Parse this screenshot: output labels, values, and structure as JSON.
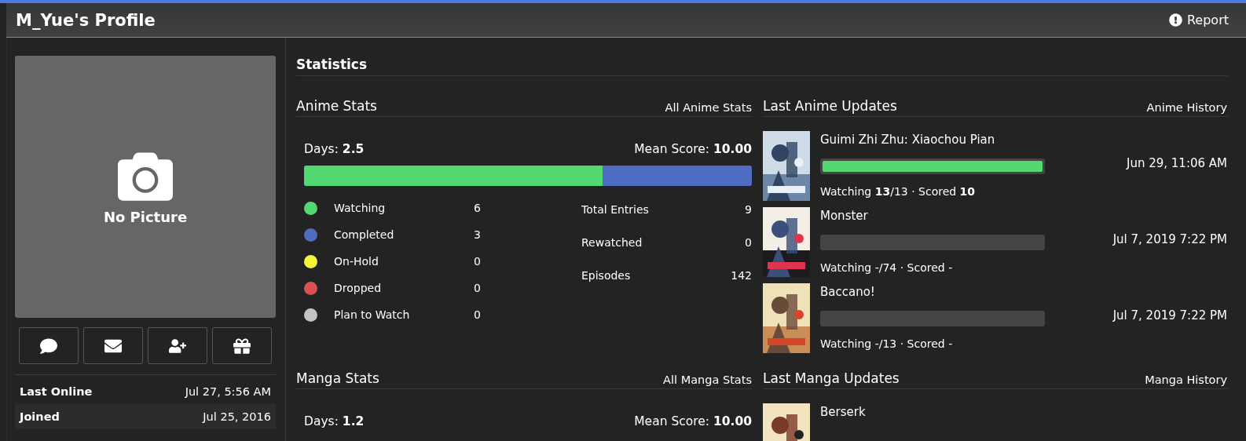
{
  "header": {
    "title": "M_Yue's Profile",
    "report": "Report"
  },
  "sidebar": {
    "picture_label": "No Picture",
    "buttons": [
      {
        "kind": "comment"
      },
      {
        "kind": "mail"
      },
      {
        "kind": "friend"
      },
      {
        "kind": "gift"
      }
    ],
    "info": [
      {
        "label": "Last Online",
        "value": "Jul 27, 5:56 AM"
      },
      {
        "label": "Joined",
        "value": "Jul 25, 2016"
      }
    ]
  },
  "statistics": {
    "title": "Statistics",
    "anime": {
      "title": "Anime Stats",
      "link": "All Anime Stats",
      "days_label": "Days:",
      "days": "2.5",
      "mean_label": "Mean Score:",
      "mean": "10.00",
      "level": 0.667,
      "statuses": [
        {
          "label": "Watching",
          "count": "6",
          "color": "#54d872"
        },
        {
          "label": "Completed",
          "count": "3",
          "color": "#4e6dc2"
        },
        {
          "label": "On-Hold",
          "count": "0",
          "color": "#f5f53a"
        },
        {
          "label": "Dropped",
          "count": "0",
          "color": "#d95151"
        },
        {
          "label": "Plan to Watch",
          "count": "0",
          "color": "#c3c3c3"
        }
      ],
      "totals": [
        {
          "label": "Total Entries",
          "value": "9"
        },
        {
          "label": "Rewatched",
          "value": "0"
        },
        {
          "label": "Episodes",
          "value": "142"
        }
      ]
    },
    "manga": {
      "title": "Manga Stats",
      "link": "All Manga Stats",
      "days_label": "Days:",
      "days": "1.2",
      "mean_label": "Mean Score:",
      "mean": "10.00"
    }
  },
  "updates": {
    "anime": {
      "title": "Last Anime Updates",
      "link": "Anime History",
      "entries": [
        {
          "title": "Guimi Zhi Zhu: Xiaochou Pian",
          "level": 1,
          "status": "Watching **13**/13 · Scored **10**",
          "date": "Jun 29, 11:06 AM"
        },
        {
          "title": "Monster",
          "status": "Watching -/74 · Scored -",
          "date": "Jul 7, 2019 7:22 PM"
        },
        {
          "title": "Baccano!",
          "status": "Watching -/13 · Scored -",
          "date": "Jul 7, 2019 7:22 PM"
        }
      ]
    },
    "manga": {
      "title": "Last Manga Updates",
      "link": "Manga History",
      "entries": [
        {
          "title": "Berserk"
        }
      ]
    }
  }
}
